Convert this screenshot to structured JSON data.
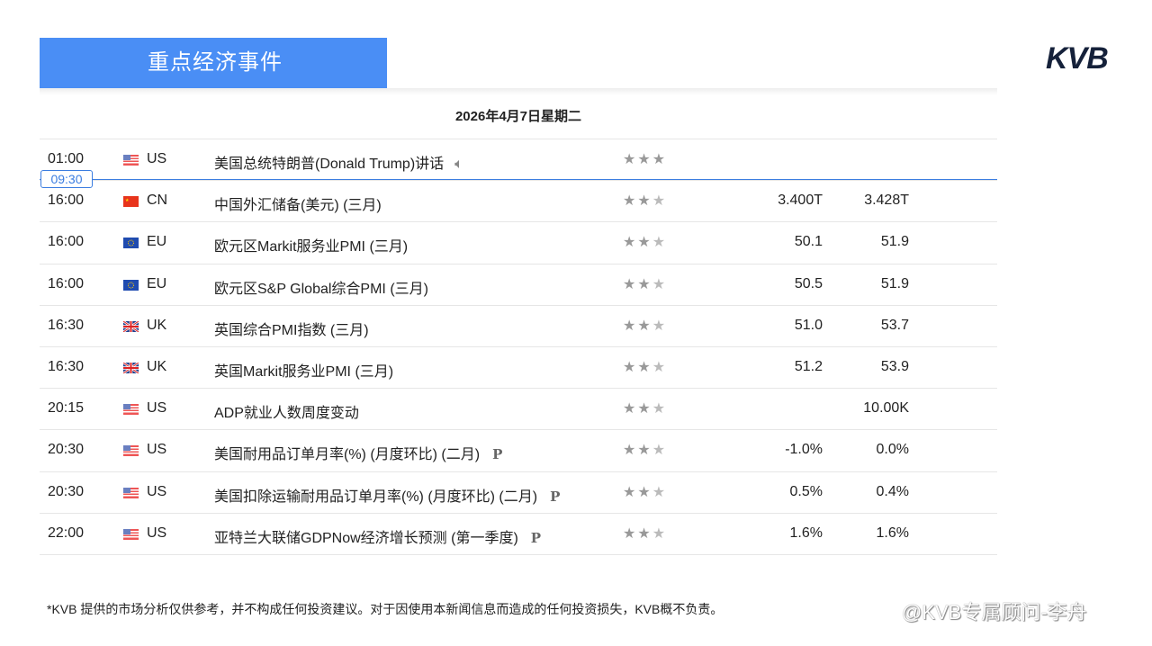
{
  "header": {
    "title": "重点经济事件",
    "logo": "KVB"
  },
  "date": "2026年4月7日星期二",
  "current_time": "09:30",
  "events": [
    {
      "time": "01:00",
      "country": "US",
      "event": "美国总统特朗普(Donald Trump)讲话",
      "stars": 3,
      "sound": true,
      "prev": "",
      "actual": ""
    },
    {
      "time": "16:00",
      "country": "CN",
      "event": "中国外汇储备(美元) (三月)",
      "stars": 2,
      "prev": "3.400T",
      "actual": "3.428T"
    },
    {
      "time": "16:00",
      "country": "EU",
      "event": "欧元区Markit服务业PMI (三月)",
      "stars": 2,
      "prev": "50.1",
      "actual": "51.9"
    },
    {
      "time": "16:00",
      "country": "EU",
      "event": "欧元区S&P Global综合PMI (三月)",
      "stars": 2,
      "prev": "50.5",
      "actual": "51.9"
    },
    {
      "time": "16:30",
      "country": "UK",
      "event": "英国综合PMI指数 (三月)",
      "stars": 2,
      "prev": "51.0",
      "actual": "53.7"
    },
    {
      "time": "16:30",
      "country": "UK",
      "event": "英国Markit服务业PMI (三月)",
      "stars": 2,
      "prev": "51.2",
      "actual": "53.9"
    },
    {
      "time": "20:15",
      "country": "US",
      "event": "ADP就业人数周度变动",
      "stars": 2,
      "prev": "",
      "actual": "10.00K"
    },
    {
      "time": "20:30",
      "country": "US",
      "event": "美国耐用品订单月率(%) (月度环比) (二月)",
      "stars": 2,
      "p": "P",
      "prev": "-1.0%",
      "actual": "0.0%"
    },
    {
      "time": "20:30",
      "country": "US",
      "event": "美国扣除运输耐用品订单月率(%) (月度环比) (二月)",
      "stars": 2,
      "p": "P",
      "prev": "0.5%",
      "actual": "0.4%"
    },
    {
      "time": "22:00",
      "country": "US",
      "event": "亚特兰大联储GDPNow经济增长预测 (第一季度)",
      "stars": 2,
      "p": "P",
      "prev": "1.6%",
      "actual": "1.6%"
    }
  ],
  "footer": "*KVB 提供的市场分析仅供参考，并不构成任何投资建议。对于因使用本新闻信息而造成的任何投资损失，KVB概不负责。",
  "watermark": "@KVB专属顾问-李舟"
}
